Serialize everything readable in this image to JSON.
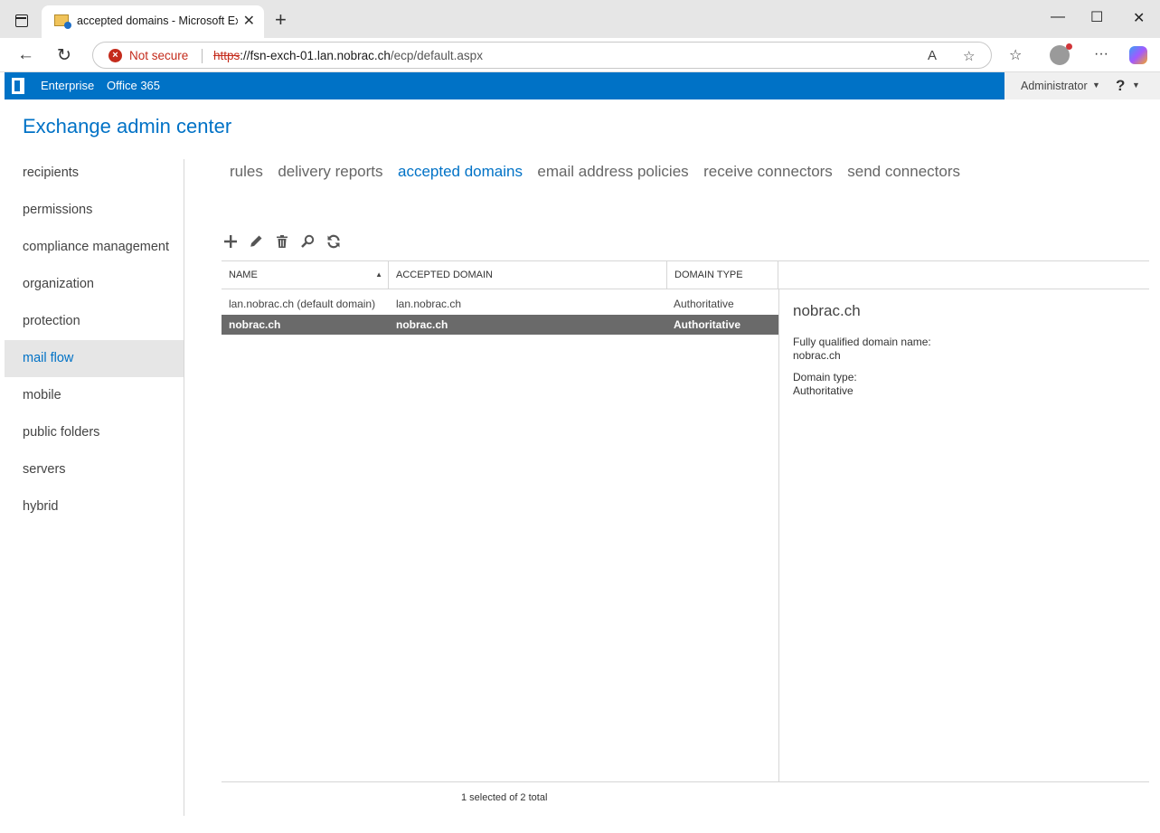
{
  "browser": {
    "tab_title": "accepted domains - Microsoft Exchange",
    "security_label": "Not secure",
    "url_protocol": "https",
    "url_host": "://fsn-exch-01.lan.nobrac.ch",
    "url_path": "/ecp/default.aspx"
  },
  "eac": {
    "nav_enterprise": "Enterprise",
    "nav_office365": "Office 365",
    "user": "Administrator",
    "help": "?",
    "title": "Exchange admin center"
  },
  "leftnav": {
    "items": [
      "recipients",
      "permissions",
      "compliance management",
      "organization",
      "protection",
      "mail flow",
      "mobile",
      "public folders",
      "servers",
      "hybrid"
    ],
    "active_index": 5
  },
  "subtabs": [
    "rules",
    "delivery reports",
    "accepted domains",
    "email address policies",
    "receive connectors",
    "send connectors"
  ],
  "grid": {
    "columns": [
      "NAME",
      "ACCEPTED DOMAIN",
      "DOMAIN TYPE"
    ],
    "rows": [
      {
        "name": "lan.nobrac.ch (default domain)",
        "domain": "lan.nobrac.ch",
        "type": "Authoritative"
      },
      {
        "name": "nobrac.ch",
        "domain": "nobrac.ch",
        "type": "Authoritative"
      }
    ],
    "status": "1 selected of 2 total"
  },
  "details": {
    "title": "nobrac.ch",
    "fqdn_label": "Fully qualified domain name:",
    "fqdn_value": "nobrac.ch",
    "type_label": "Domain type:",
    "type_value": "Authoritative"
  }
}
